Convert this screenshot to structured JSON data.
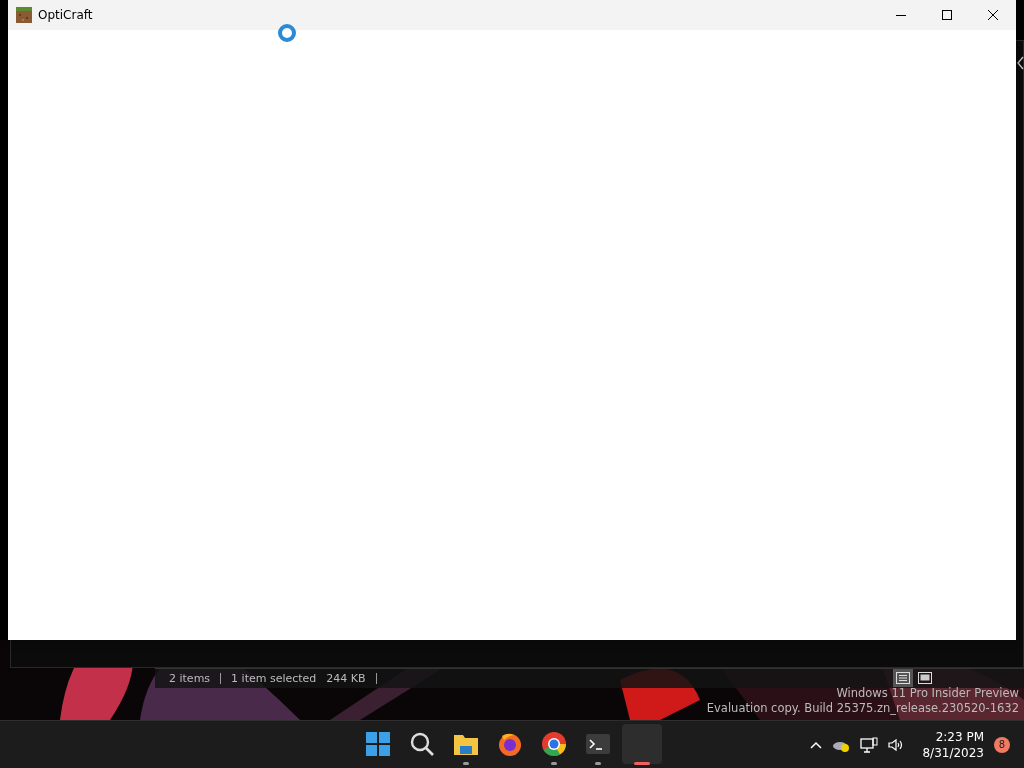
{
  "window": {
    "title": "OptiCraft",
    "loading": true
  },
  "background_window": {
    "status_bar": {
      "item_count": "2 items",
      "selection": "1 item selected",
      "size": "244 KB"
    },
    "view_buttons": [
      {
        "kind": "details",
        "selected": true
      },
      {
        "kind": "thumbnails",
        "selected": false
      }
    ]
  },
  "desktop_notice": {
    "line_1": "Windows 11 Pro Insider Preview",
    "line_2": "Evaluation copy. Build 25375.zn_release.230520-1632"
  },
  "taskbar": {
    "apps": [
      {
        "kind": "start",
        "running": false,
        "selected": false
      },
      {
        "kind": "search",
        "running": false,
        "selected": false
      },
      {
        "kind": "files",
        "running": true,
        "selected": false
      },
      {
        "kind": "firefox",
        "running": false,
        "selected": false
      },
      {
        "kind": "chrome",
        "running": true,
        "selected": false
      },
      {
        "kind": "terminal",
        "running": true,
        "selected": false
      },
      {
        "kind": "blank",
        "running": true,
        "selected": true
      }
    ],
    "clock": {
      "time": "2:23 PM",
      "date": "8/31/2023"
    },
    "notification_count": "8"
  }
}
